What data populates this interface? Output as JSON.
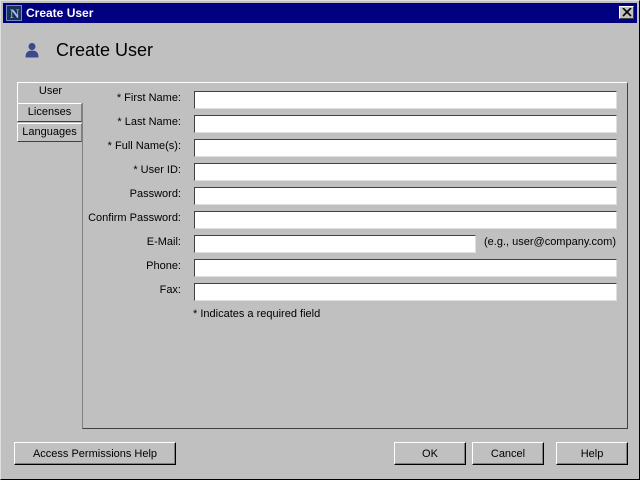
{
  "window": {
    "title": "Create User"
  },
  "header": {
    "title": "Create User",
    "icon": "user-icon"
  },
  "tabs": [
    {
      "label": "User",
      "active": true
    },
    {
      "label": "Licenses",
      "active": false
    },
    {
      "label": "Languages",
      "active": false
    }
  ],
  "form": {
    "first_name": {
      "label": "* First Name:",
      "value": ""
    },
    "last_name": {
      "label": "* Last Name:",
      "value": ""
    },
    "full_name": {
      "label": "* Full Name(s):",
      "value": ""
    },
    "user_id": {
      "label": "* User ID:",
      "value": ""
    },
    "password": {
      "label": "Password:",
      "value": ""
    },
    "confirm_password": {
      "label": "Confirm Password:",
      "value": ""
    },
    "email": {
      "label": "E-Mail:",
      "value": "",
      "hint": "(e.g., user@company.com)"
    },
    "phone": {
      "label": "Phone:",
      "value": ""
    },
    "fax": {
      "label": "Fax:",
      "value": ""
    },
    "required_note": "* Indicates a required field"
  },
  "buttons": {
    "access_help": "Access Permissions Help",
    "ok": "OK",
    "cancel": "Cancel",
    "help": "Help"
  },
  "colors": {
    "titlebar": "#000080",
    "face": "#c0c0c0",
    "user_icon": "#3c4a8c"
  }
}
